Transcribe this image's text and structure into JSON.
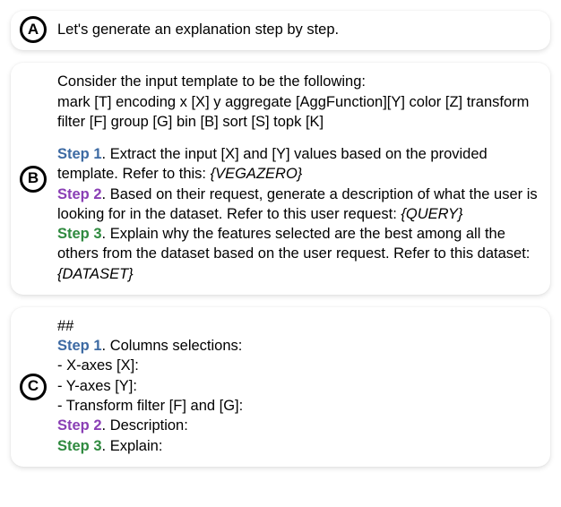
{
  "cardA": {
    "badge": "A",
    "text": "Let's generate an explanation step by step."
  },
  "cardB": {
    "badge": "B",
    "intro1": "Consider the input template to be the following:",
    "intro2": "mark [T] encoding x [X] y aggregate [AggFunction][Y] color [Z] transform filter [F] group [G] bin [B] sort [S] topk [K]",
    "step1_label": "Step 1",
    "step1_text_a": ". Extract the input [X] and [Y] values based on the provided template. Refer to this: ",
    "step1_ph": "{VEGAZERO}",
    "step2_label": "Step 2",
    "step2_text_a": ". Based on their request, generate a description of what the user is looking for in the dataset. Refer to this user request: ",
    "step2_ph": "{QUERY}",
    "step3_label": "Step 3",
    "step3_text_a": ". Explain why the features selected are the best among all the others from the dataset based on the user request. Refer to this dataset: ",
    "step3_ph": "{DATASET}"
  },
  "cardC": {
    "badge": "C",
    "hash": "##",
    "step1_label": "Step 1",
    "step1_tail": ". Columns selections:",
    "line_x": "- X-axes [X]:",
    "line_y": "- Y-axes [Y]:",
    "line_fg": "- Transform filter [F] and [G]:",
    "step2_label": "Step 2",
    "step2_tail": ". Description:",
    "step3_label": "Step 3",
    "step3_tail": ". Explain:"
  }
}
